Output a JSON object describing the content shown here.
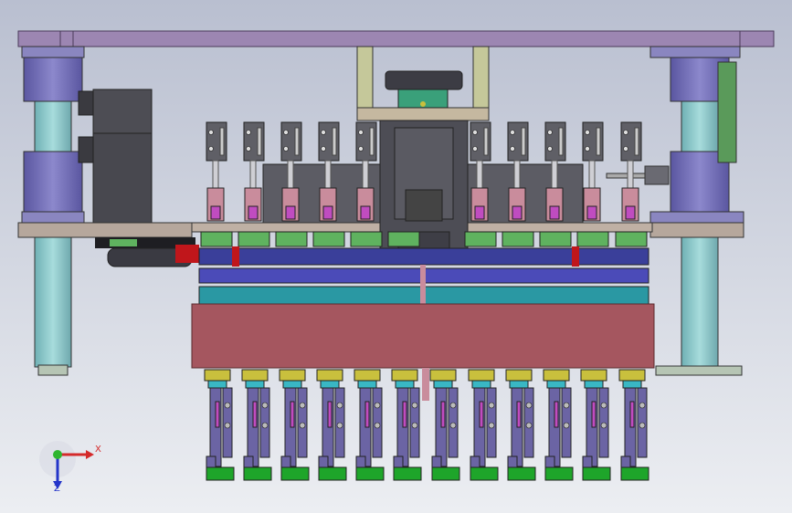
{
  "triad": {
    "x_label": "X",
    "z_label": "Z"
  },
  "colors": {
    "background_top": "#b9bfd0",
    "background_bottom": "#e8eaf0",
    "top_plate": "#9c86b2",
    "column": "#8fc7c9",
    "column_cap": "#7b76ba",
    "frame": "#b6a79c",
    "mount_block": "#5c5c64",
    "cylinder_head": "#5f5f66",
    "rod": "#cfcfd4",
    "guide_pink": "#c98c9c",
    "nut_magenta": "#c04cc0",
    "gear_green": "#5fb25f",
    "gear_blue": "#5a5fc8",
    "gear_teal": "#2aa8b3",
    "red_accent": "#c0161b",
    "main_block": "#a5565f",
    "gripper_yellow": "#c9c03d",
    "gripper_cyan": "#39b7c4",
    "gripper_purple": "#6b64a4",
    "gripper_green": "#1ea52a",
    "axis_x": "#d42a2a",
    "axis_y": "#2fb52f",
    "axis_z": "#2435c9"
  }
}
